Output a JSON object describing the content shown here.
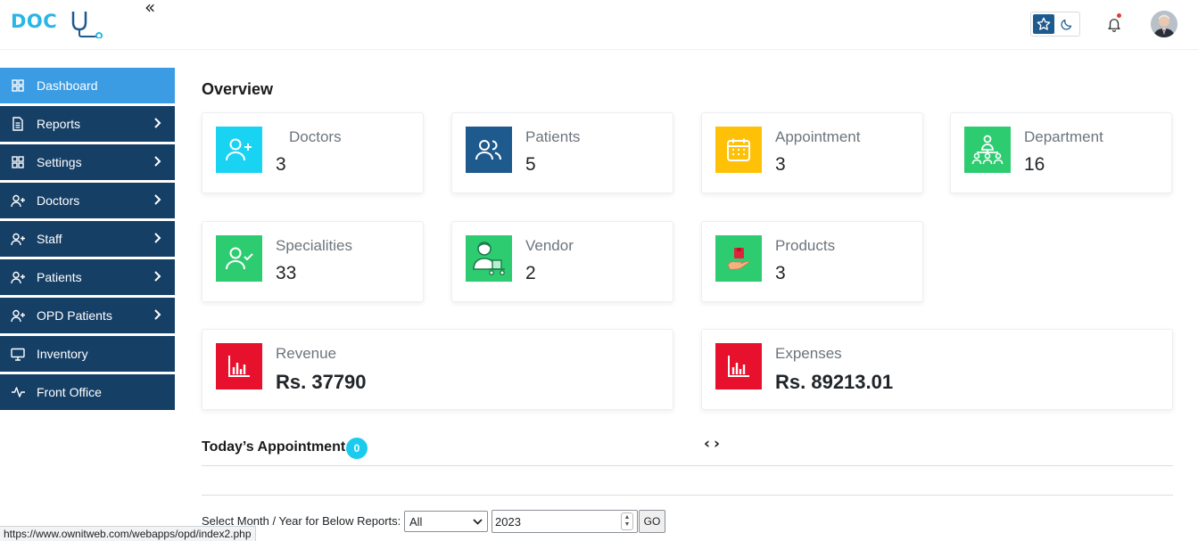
{
  "brand": {
    "logo_text": "DOC"
  },
  "header": {
    "collapse_glyph": "«",
    "theme_light_icon": "star-icon",
    "theme_dark_icon": "moon-icon",
    "notification_icon": "bell-icon"
  },
  "sidebar": {
    "items": [
      {
        "label": "Dashboard",
        "icon": "grid-icon",
        "active": true,
        "has_submenu": false
      },
      {
        "label": "Reports",
        "icon": "document-icon",
        "active": false,
        "has_submenu": true
      },
      {
        "label": "Settings",
        "icon": "grid-icon",
        "active": false,
        "has_submenu": true
      },
      {
        "label": "Doctors",
        "icon": "user-add-icon",
        "active": false,
        "has_submenu": true
      },
      {
        "label": "Staff",
        "icon": "user-add-icon",
        "active": false,
        "has_submenu": true
      },
      {
        "label": "Patients",
        "icon": "user-add-icon",
        "active": false,
        "has_submenu": true
      },
      {
        "label": "OPD Patients",
        "icon": "user-add-icon",
        "active": false,
        "has_submenu": true
      },
      {
        "label": "Inventory",
        "icon": "monitor-icon",
        "active": false,
        "has_submenu": false
      },
      {
        "label": "Front Office",
        "icon": "activity-icon",
        "active": false,
        "has_submenu": false
      }
    ]
  },
  "overview": {
    "title": "Overview",
    "cards": [
      {
        "label": "Doctors",
        "value": "3",
        "icon": "user-add-icon",
        "color": "#19d3f3"
      },
      {
        "label": "Patients",
        "value": "5",
        "icon": "users-icon",
        "color": "#1e5a8e"
      },
      {
        "label": "Appointment",
        "value": "3",
        "icon": "calendar-icon",
        "color": "#ffc107"
      },
      {
        "label": "Department",
        "value": "16",
        "icon": "hierarchy-icon",
        "color": "#2ecc71"
      },
      {
        "label": "Specialities",
        "value": "33",
        "icon": "user-check-icon",
        "color": "#2ecc71"
      },
      {
        "label": "Vendor",
        "value": "2",
        "icon": "vendor-icon",
        "color": "#2ecc71"
      },
      {
        "label": "Products",
        "value": "3",
        "icon": "product-hand-icon",
        "color": "#2ecc71"
      }
    ],
    "finance": [
      {
        "label": "Revenue",
        "value": "Rs. 37790",
        "icon": "bar-chart-icon",
        "color": "#e8112d"
      },
      {
        "label": "Expenses",
        "value": "Rs. 89213.01",
        "icon": "bar-chart-icon",
        "color": "#e8112d"
      }
    ]
  },
  "appointments": {
    "title": "Today’s Appointment",
    "count": "0",
    "prev_glyph": "‹",
    "next_glyph": "›"
  },
  "report_filter": {
    "label": "Select Month / Year for Below Reports:",
    "month_selected": "All",
    "year_value": "2023",
    "go_label": "GO"
  },
  "status_bar": {
    "url": "https://www.ownitweb.com/webapps/opd/index2.php"
  }
}
